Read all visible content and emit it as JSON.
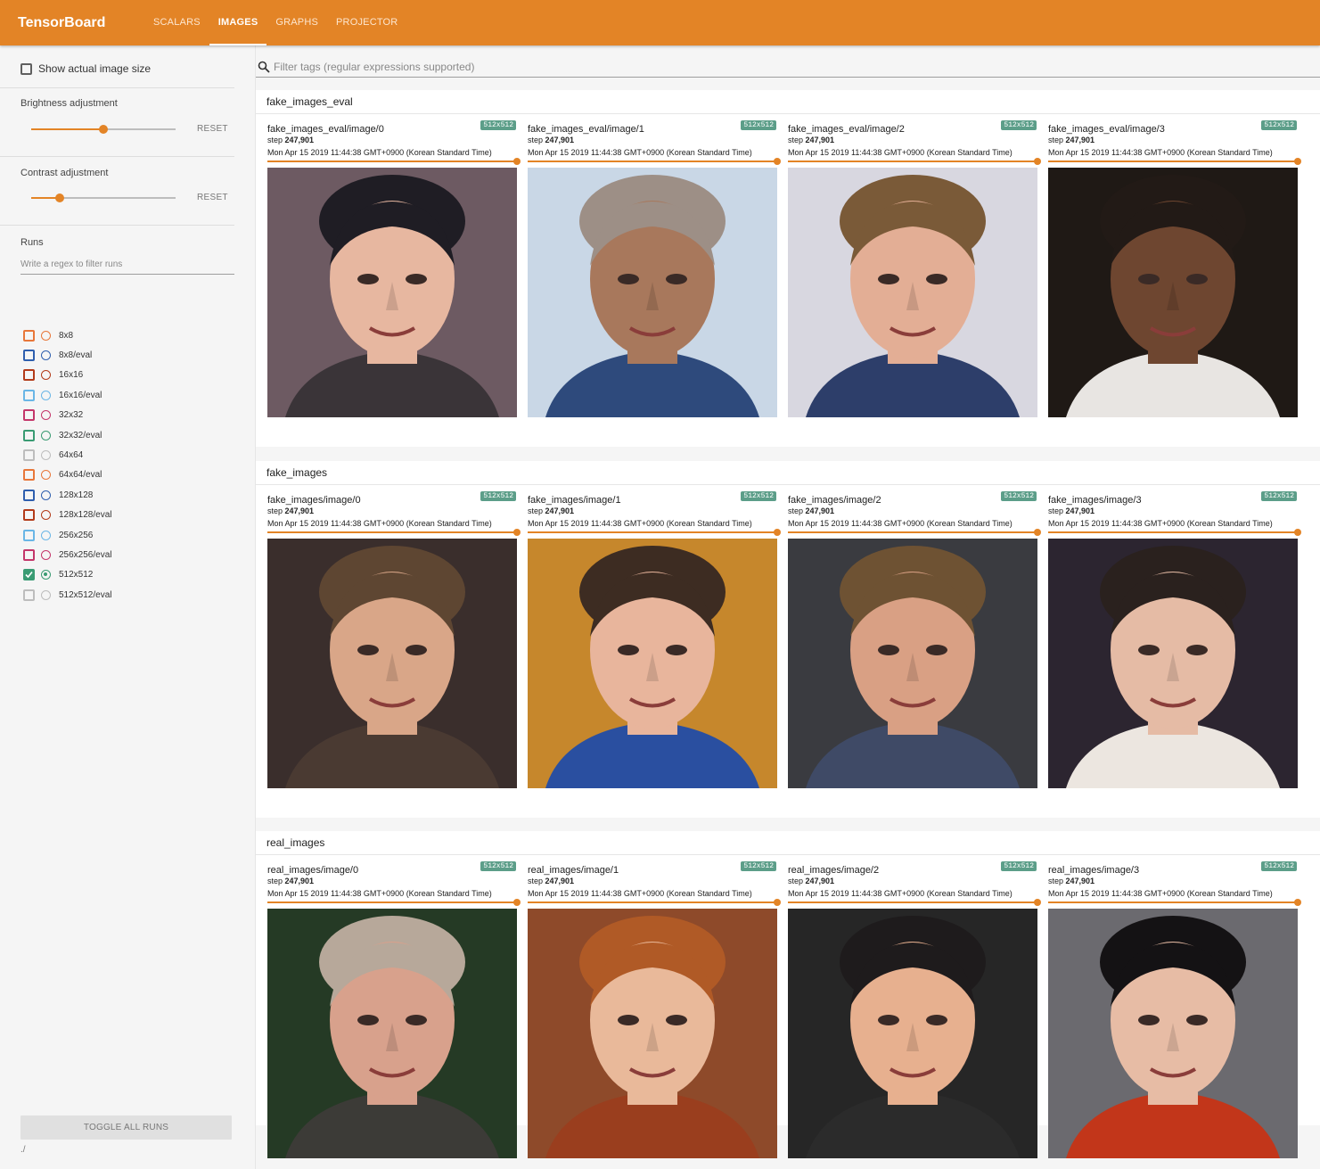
{
  "app": {
    "title": "TensorBoard"
  },
  "nav": {
    "tabs": [
      "SCALARS",
      "IMAGES",
      "GRAPHS",
      "PROJECTOR"
    ],
    "active": "IMAGES"
  },
  "sidebar": {
    "show_actual_size": "Show actual image size",
    "brightness": {
      "label": "Brightness adjustment",
      "reset": "RESET",
      "value": 0.5
    },
    "contrast": {
      "label": "Contrast adjustment",
      "reset": "RESET",
      "value": 0.2
    },
    "runs": {
      "label": "Runs",
      "filter_placeholder": "Write a regex to filter runs",
      "items": [
        {
          "name": "8x8",
          "color": "#e8773a",
          "checked": false
        },
        {
          "name": "8x8/eval",
          "color": "#2f5fae",
          "checked": false
        },
        {
          "name": "16x16",
          "color": "#b33b1a",
          "checked": false
        },
        {
          "name": "16x16/eval",
          "color": "#6ab6e6",
          "checked": false
        },
        {
          "name": "32x32",
          "color": "#c4376a",
          "checked": false
        },
        {
          "name": "32x32/eval",
          "color": "#3a9b73",
          "checked": false
        },
        {
          "name": "64x64",
          "color": "#bdbdbd",
          "checked": false
        },
        {
          "name": "64x64/eval",
          "color": "#e8773a",
          "checked": false
        },
        {
          "name": "128x128",
          "color": "#2f5fae",
          "checked": false
        },
        {
          "name": "128x128/eval",
          "color": "#b33b1a",
          "checked": false
        },
        {
          "name": "256x256",
          "color": "#6ab6e6",
          "checked": false
        },
        {
          "name": "256x256/eval",
          "color": "#c4376a",
          "checked": false
        },
        {
          "name": "512x512",
          "color": "#3a9b73",
          "checked": true
        },
        {
          "name": "512x512/eval",
          "color": "#bdbdbd",
          "checked": false
        }
      ]
    },
    "toggle_all": "TOGGLE ALL RUNS",
    "logdir": "./"
  },
  "search": {
    "placeholder": "Filter tags (regular expressions supported)"
  },
  "panes": [
    {
      "title": "fake_images_eval",
      "cards": [
        {
          "tag": "fake_images_eval/image/0",
          "badge": "512x512",
          "step_label": "step",
          "step": "247,901",
          "time": "Mon Apr 15 2019 11:44:38 GMT+0900 (Korean Standard Time)"
        },
        {
          "tag": "fake_images_eval/image/1",
          "badge": "512x512",
          "step_label": "step",
          "step": "247,901",
          "time": "Mon Apr 15 2019 11:44:38 GMT+0900 (Korean Standard Time)"
        },
        {
          "tag": "fake_images_eval/image/2",
          "badge": "512x512",
          "step_label": "step",
          "step": "247,901",
          "time": "Mon Apr 15 2019 11:44:38 GMT+0900 (Korean Standard Time)"
        },
        {
          "tag": "fake_images_eval/image/3",
          "badge": "512x512",
          "step_label": "step",
          "step": "247,901",
          "time": "Mon Apr 15 2019 11:44:38 GMT+0900 (Korean Standard Time)"
        }
      ]
    },
    {
      "title": "fake_images",
      "cards": [
        {
          "tag": "fake_images/image/0",
          "badge": "512x512",
          "step_label": "step",
          "step": "247,901",
          "time": "Mon Apr 15 2019 11:44:38 GMT+0900 (Korean Standard Time)"
        },
        {
          "tag": "fake_images/image/1",
          "badge": "512x512",
          "step_label": "step",
          "step": "247,901",
          "time": "Mon Apr 15 2019 11:44:38 GMT+0900 (Korean Standard Time)"
        },
        {
          "tag": "fake_images/image/2",
          "badge": "512x512",
          "step_label": "step",
          "step": "247,901",
          "time": "Mon Apr 15 2019 11:44:38 GMT+0900 (Korean Standard Time)"
        },
        {
          "tag": "fake_images/image/3",
          "badge": "512x512",
          "step_label": "step",
          "step": "247,901",
          "time": "Mon Apr 15 2019 11:44:38 GMT+0900 (Korean Standard Time)"
        }
      ]
    },
    {
      "title": "real_images",
      "cards": [
        {
          "tag": "real_images/image/0",
          "badge": "512x512",
          "step_label": "step",
          "step": "247,901",
          "time": "Mon Apr 15 2019 11:44:38 GMT+0900 (Korean Standard Time)"
        },
        {
          "tag": "real_images/image/1",
          "badge": "512x512",
          "step_label": "step",
          "step": "247,901",
          "time": "Mon Apr 15 2019 11:44:38 GMT+0900 (Korean Standard Time)"
        },
        {
          "tag": "real_images/image/2",
          "badge": "512x512",
          "step_label": "step",
          "step": "247,901",
          "time": "Mon Apr 15 2019 11:44:38 GMT+0900 (Korean Standard Time)"
        },
        {
          "tag": "real_images/image/3",
          "badge": "512x512",
          "step_label": "step",
          "step": "247,901",
          "time": "Mon Apr 15 2019 11:44:38 GMT+0900 (Korean Standard Time)"
        }
      ]
    }
  ],
  "portrait_palettes": [
    {
      "bg": "#6d5a62",
      "skin": "#e7b7a0",
      "hair": "#1f1d24",
      "cloth": "#3a3438",
      "accent": "#1b1a2a"
    },
    {
      "bg": "#c9d7e6",
      "skin": "#a8785c",
      "hair": "#9d8f86",
      "cloth": "#2e4a7c",
      "accent": "#c8c2bf"
    },
    {
      "bg": "#d8d7e0",
      "skin": "#e3ae95",
      "hair": "#7a5a38",
      "cloth": "#2d3e6a",
      "accent": "#ffffff"
    },
    {
      "bg": "#1f1915",
      "skin": "#6e4630",
      "hair": "#221a16",
      "cloth": "#e8e5e2",
      "accent": "#2a2220"
    },
    {
      "bg": "#3a2e2c",
      "skin": "#d9a688",
      "hair": "#5e4632",
      "cloth": "#4a3a32",
      "accent": "#d4d23a"
    },
    {
      "bg": "#c6872c",
      "skin": "#e8b59c",
      "hair": "#3d2c22",
      "cloth": "#2a4fa0",
      "accent": "#c8c8d8"
    },
    {
      "bg": "#3a3b40",
      "skin": "#d9a084",
      "hair": "#6e5233",
      "cloth": "#3f4a66",
      "accent": "#3a3b40"
    },
    {
      "bg": "#2c2530",
      "skin": "#e5bba5",
      "hair": "#2a211e",
      "cloth": "#ece6e0",
      "accent": "#c23c6a"
    },
    {
      "bg": "#253a25",
      "skin": "#d8a18c",
      "hair": "#b7a89a",
      "cloth": "#3c3b37",
      "accent": "#d3262e"
    },
    {
      "bg": "#8e4a2a",
      "skin": "#e9b99a",
      "hair": "#b05a26",
      "cloth": "#9a3e1e",
      "accent": "#e2c86c"
    },
    {
      "bg": "#262626",
      "skin": "#e7b08f",
      "hair": "#1e1b1c",
      "cloth": "#2b2b2b",
      "accent": "#b8b8b8"
    },
    {
      "bg": "#6b6a6f",
      "skin": "#e7bca5",
      "hair": "#141214",
      "cloth": "#c2361a",
      "accent": "#d1352a"
    }
  ]
}
